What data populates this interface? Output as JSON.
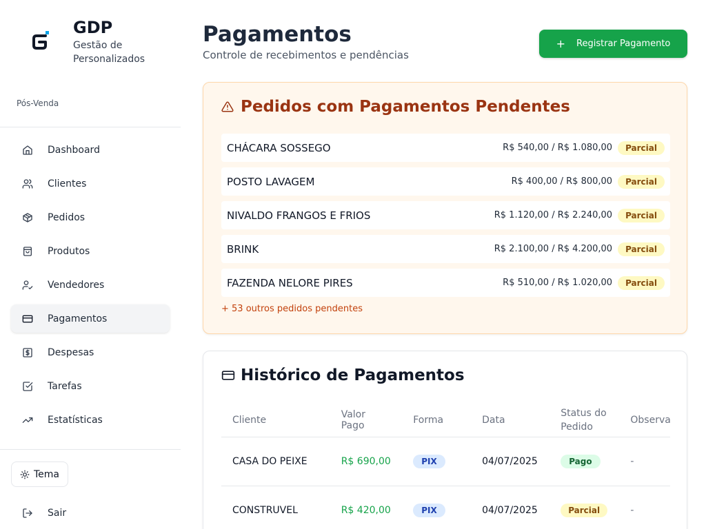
{
  "app": {
    "title": "GDP",
    "subtitle": "Gestão de Personalizados",
    "role": "Pós-Venda"
  },
  "sidebar": {
    "items": [
      {
        "label": "Dashboard",
        "icon": "home-icon"
      },
      {
        "label": "Clientes",
        "icon": "users-icon"
      },
      {
        "label": "Pedidos",
        "icon": "package-icon"
      },
      {
        "label": "Produtos",
        "icon": "shopping-bag-icon"
      },
      {
        "label": "Vendedores",
        "icon": "user-check-icon"
      },
      {
        "label": "Pagamentos",
        "icon": "credit-card-icon",
        "active": true
      },
      {
        "label": "Despesas",
        "icon": "receipt-icon"
      },
      {
        "label": "Tarefas",
        "icon": "checkbox-icon"
      },
      {
        "label": "Estatísticas",
        "icon": "trending-up-icon"
      }
    ],
    "theme_label": "Tema",
    "logout_label": "Sair"
  },
  "header": {
    "title": "Pagamentos",
    "subtitle": "Controle de recebimentos e pendências",
    "register_button": "Registrar Pagamento",
    "register_icon": "+"
  },
  "pending": {
    "title": "Pedidos com Pagamentos Pendentes",
    "rows": [
      {
        "name": "CHÁCARA SOSSEGO",
        "amount": "R$ 540,00 / R$ 1.080,00",
        "status": "Parcial"
      },
      {
        "name": "POSTO LAVAGEM",
        "amount": "R$ 400,00 / R$ 800,00",
        "status": "Parcial"
      },
      {
        "name": "NIVALDO FRANGOS E FRIOS",
        "amount": "R$ 1.120,00 / R$ 2.240,00",
        "status": "Parcial"
      },
      {
        "name": "BRINK",
        "amount": "R$ 2.100,00 / R$ 4.200,00",
        "status": "Parcial"
      },
      {
        "name": "FAZENDA NELORE PIRES",
        "amount": "R$ 510,00 / R$ 1.020,00",
        "status": "Parcial"
      }
    ],
    "more": "+ 53 outros pedidos pendentes"
  },
  "history": {
    "title": "Histórico de Pagamentos",
    "columns": [
      "Cliente",
      "Valor Pago",
      "Forma",
      "Data",
      "Status do Pedido",
      "Observações"
    ],
    "rows": [
      {
        "cliente": "CASA DO PEIXE",
        "valor": "R$ 690,00",
        "forma": "PIX",
        "data": "04/07/2025",
        "status": "Pago",
        "obs": "-"
      },
      {
        "cliente": "CONSTRUVEL",
        "valor": "R$ 420,00",
        "forma": "PIX",
        "data": "04/07/2025",
        "status": "Parcial",
        "obs": "-"
      }
    ]
  },
  "colors": {
    "primary": "#16a34a",
    "pending_bg": "#fff7ed",
    "pending_title": "#9a3412",
    "partial_bg": "#fef9c3",
    "paid_bg": "#dcfce7",
    "pix_bg": "#dbeafe"
  }
}
